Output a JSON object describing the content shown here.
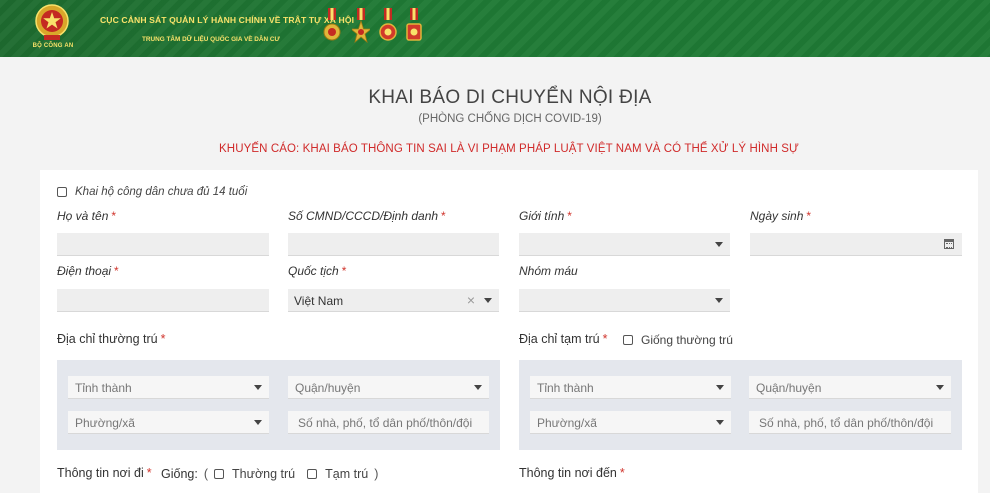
{
  "header": {
    "org_title": "CỤC CẢNH SÁT QUẢN LÝ HÀNH CHÍNH VỀ TRẬT TỰ XÃ HỘI",
    "org_subtitle": "TRUNG TÂM DỮ LIỆU QUỐC GIA VỀ DÂN CƯ",
    "emblem_label": "BỘ CÔNG AN",
    "colors": {
      "banner": "#1f7a35",
      "gold": "#f8e26a"
    }
  },
  "page": {
    "title": "KHAI BÁO DI CHUYỂN NỘI ĐỊA",
    "subtitle": "(PHÒNG CHỐNG DỊCH COVID-19)",
    "warning": "KHUYẾN CÁO: KHAI BÁO THÔNG TIN SAI LÀ VI PHẠM PHÁP LUẬT VIỆT NAM VÀ CÓ THỂ XỬ LÝ HÌNH SỰ"
  },
  "form": {
    "proxy_declare_label": "Khai hộ công dân chưa đủ 14 tuổi",
    "required_mark": "*",
    "full_name_label": "Họ và tên",
    "id_number_label": "Số CMND/CCCD/Định danh",
    "gender_label": "Giới tính",
    "birth_date_label": "Ngày sinh",
    "phone_label": "Điện thoại",
    "nationality_label": "Quốc tịch",
    "nationality_value": "Việt Nam",
    "blood_type_label": "Nhóm máu",
    "permanent_address_label": "Địa chỉ thường trú",
    "temporary_address_label": "Địa chỉ tạm trú",
    "same_as_permanent_label": "Giống thường trú",
    "province_placeholder": "Tỉnh thành",
    "district_placeholder": "Quận/huyện",
    "ward_placeholder": "Phường/xã",
    "street_placeholder": "Số nhà, phố, tổ dân phố/thôn/đội",
    "departure_label": "Thông tin nơi đi",
    "same_label": "Giống:",
    "paren_open": "(",
    "paren_close": ")",
    "same_permanent_option": "Thường trú",
    "same_temporary_option": "Tạm trú",
    "destination_label": "Thông tin nơi đến",
    "clear_icon": "×",
    "icons": [
      "caret-down-icon",
      "calendar-icon",
      "clear-icon"
    ]
  }
}
